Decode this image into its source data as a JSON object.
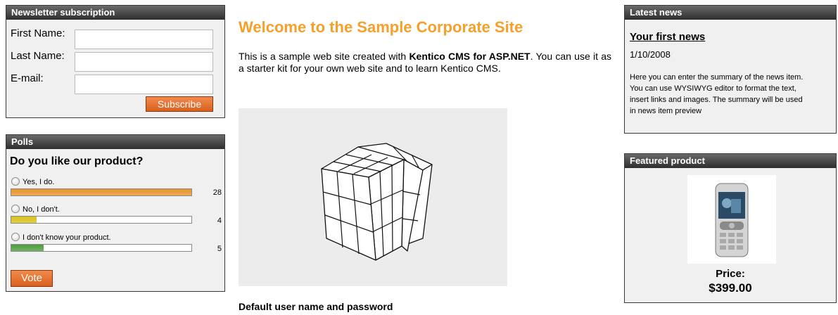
{
  "newsletter": {
    "title": "Newsletter subscription",
    "first_name_label": "First Name:",
    "last_name_label": "Last Name:",
    "email_label": "E-mail:",
    "first_name_value": "",
    "last_name_value": "",
    "email_value": "",
    "subscribe_label": "Subscribe"
  },
  "polls": {
    "title": "Polls",
    "question": "Do you like our product?",
    "answers": [
      {
        "label": "Yes, I do.",
        "count": "28",
        "fraction": 1.0,
        "color": "#e8942b"
      },
      {
        "label": "No, I don't.",
        "count": "4",
        "fraction": 0.14,
        "color": "#d7c21a"
      },
      {
        "label": "I don't know your product.",
        "count": "5",
        "fraction": 0.18,
        "color": "#4f9d3f"
      }
    ],
    "vote_label": "Vote"
  },
  "main": {
    "heading": "Welcome to the Sample Corporate Site",
    "intro_prefix": "This is a sample web site created with ",
    "intro_bold": "Kentico CMS for ASP.NET",
    "intro_suffix": ". You can use it as a starter kit for your own web site and to learn Kentico CMS.",
    "default_heading": "Default user name and password"
  },
  "latest_news": {
    "title": "Latest news",
    "item_title": "Your first news",
    "item_date": "1/10/2008",
    "item_summary": "Here you can enter the summary of the news item. You can use WYSIWYG editor to format the text, insert links and images. The summary will be used in news item preview"
  },
  "featured": {
    "title": "Featured product",
    "price_label": "Price:",
    "price_value": "$399.00"
  },
  "colors": {
    "accent_orange": "#f5a02a",
    "button_orange": "#e06a2a",
    "box_header_dark": "#2d2d2d"
  }
}
